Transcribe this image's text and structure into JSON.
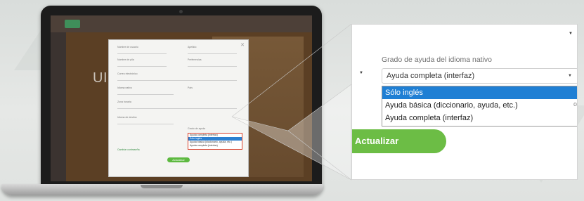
{
  "screen": {
    "background_text": "UI                    ro",
    "dialog": {
      "labels": [
        "Nombre de usuario",
        "Apellido",
        "Nombre de pila",
        "Preferencias",
        "Correo electrónico",
        "Idioma nativo",
        "País",
        "Zona horaria",
        "Idioma de destino",
        "Grado de ayuda"
      ],
      "dropdown_options": [
        "Ayuda completa (interfaz)",
        "Sólo inglés",
        "Ayuda básica (diccionario, ayuda, etc.)",
        "Ayuda completa (interfaz)"
      ],
      "link": "Cambiar contraseña",
      "button": "Actualizar"
    }
  },
  "callout": {
    "field_label": "Grado de ayuda del idioma nativo",
    "selected_value": "Ayuda completa (interfaz)",
    "options": [
      "Sólo inglés",
      "Ayuda básica (diccionario, ayuda, etc.)",
      "Ayuda completa (interfaz)"
    ],
    "highlighted_option": "Sólo inglés",
    "update_button": "Actualizar",
    "edge_text": "o"
  },
  "colors": {
    "accent_green": "#6cbd45",
    "selection_blue": "#1f7fd4",
    "highlight_red": "#d8402c"
  }
}
